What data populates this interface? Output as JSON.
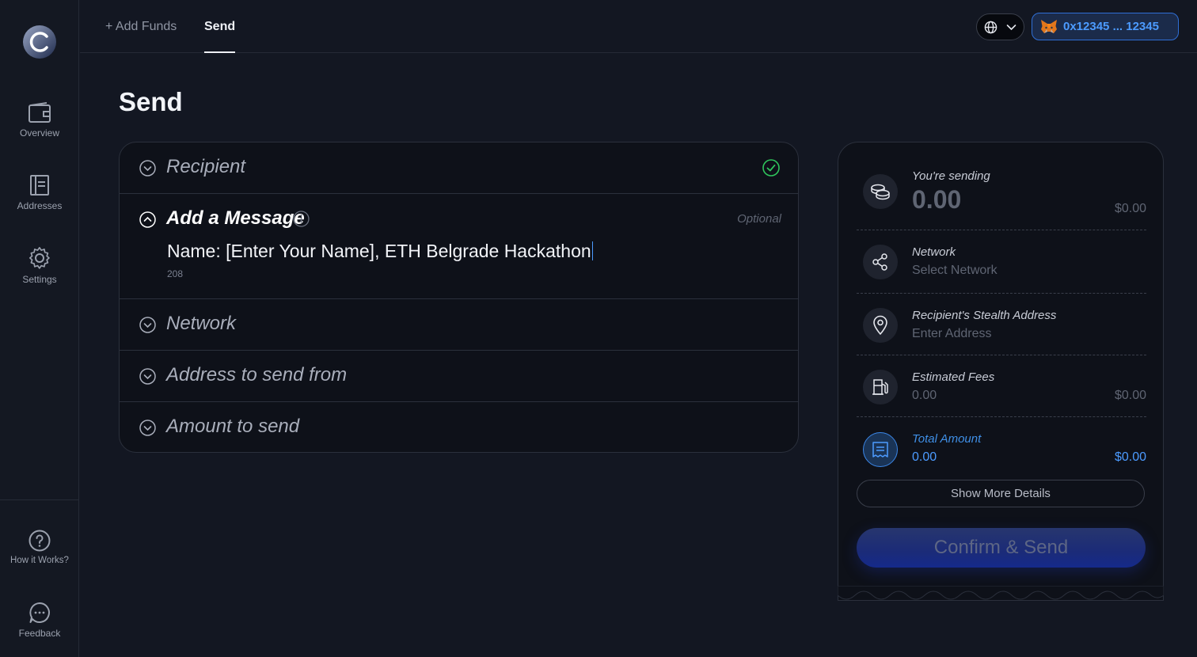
{
  "nav": {
    "top_links": [
      {
        "label": "+ Add Funds",
        "active": false
      },
      {
        "label": "Send",
        "active": true
      }
    ],
    "wallet_address": "0x12345 ... 12345"
  },
  "sidebar": {
    "items": [
      {
        "label": "Overview",
        "icon": "wallet-icon"
      },
      {
        "label": "Addresses",
        "icon": "document-icon"
      },
      {
        "label": "Settings",
        "icon": "gear-icon"
      }
    ],
    "bottom_items": [
      {
        "label": "How it Works?",
        "icon": "help-icon"
      },
      {
        "label": "Feedback",
        "icon": "chat-icon"
      }
    ]
  },
  "page": {
    "title": "Send"
  },
  "form": {
    "recipient_title": "Recipient",
    "message_title": "Add a Message",
    "message_optional": "Optional",
    "message_value": "Name: [Enter Your Name], ETH Belgrade Hackathon",
    "message_count": "208",
    "network_title": "Network",
    "from_title": "Address to send from",
    "amount_title": "Amount to send"
  },
  "summary": {
    "sending_label": "You're sending",
    "sending_amount": "0.00",
    "sending_usd": "$0.00",
    "network_label": "Network",
    "network_value": "Select Network",
    "stealth_label": "Recipient's Stealth Address",
    "stealth_value": "Enter Address",
    "fees_label": "Estimated Fees",
    "fees_value": "0.00",
    "fees_usd": "$0.00",
    "total_label": "Total Amount",
    "total_value": "0.00",
    "total_usd": "$0.00",
    "more_details": "Show More Details",
    "confirm": "Confirm & Send"
  },
  "colors": {
    "background": "#131722",
    "card": "#0e1119",
    "accent_blue": "#4c9bff",
    "success_green": "#2fc55c"
  }
}
